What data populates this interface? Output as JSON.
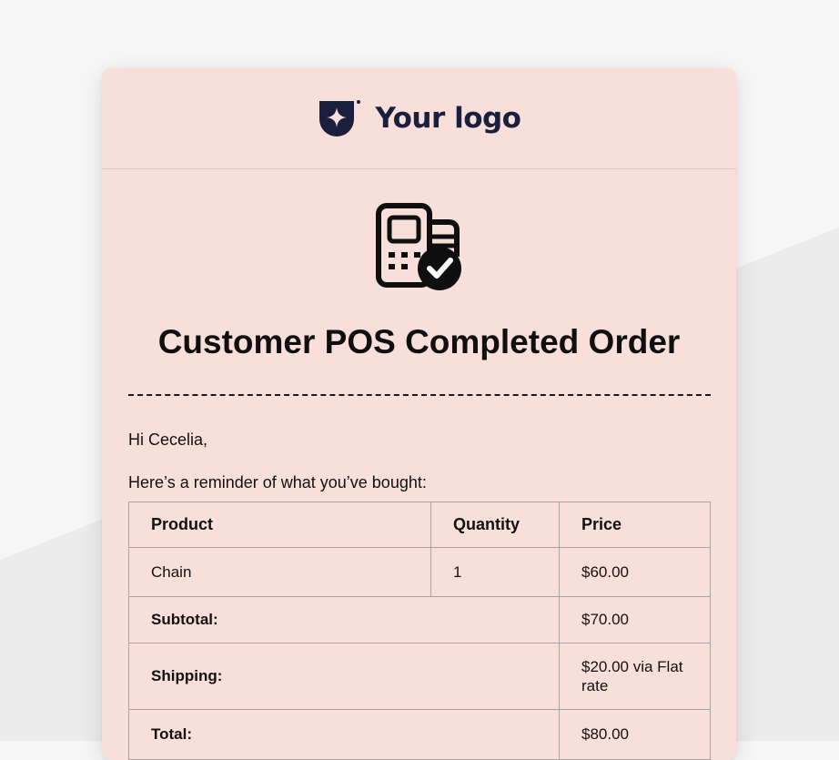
{
  "colors": {
    "page_background": "#f6f6f7",
    "background_shape": "#ebebec",
    "card_background": "#f9dfda",
    "logo_color": "#1a1f3d",
    "text_color": "#111111"
  },
  "header": {
    "logo_icon": "shield-star-logo-icon",
    "logo_text": "Your logo"
  },
  "hero": {
    "icon": "pos-terminal-check-icon",
    "title": "Customer POS Completed Order"
  },
  "body": {
    "greeting": "Hi Cecelia,",
    "intro": "Here’s a reminder of what you’ve bought:"
  },
  "order_table": {
    "headers": [
      "Product",
      "Quantity",
      "Price"
    ],
    "items": [
      {
        "product": "Chain",
        "quantity": "1",
        "price": "$60.00"
      }
    ],
    "subtotal": {
      "label": "Subtotal:",
      "value": "$70.00"
    },
    "shipping": {
      "label": "Shipping:",
      "value": "$20.00 via Flat rate"
    },
    "total": {
      "label": "Total:",
      "value": "$80.00"
    }
  }
}
